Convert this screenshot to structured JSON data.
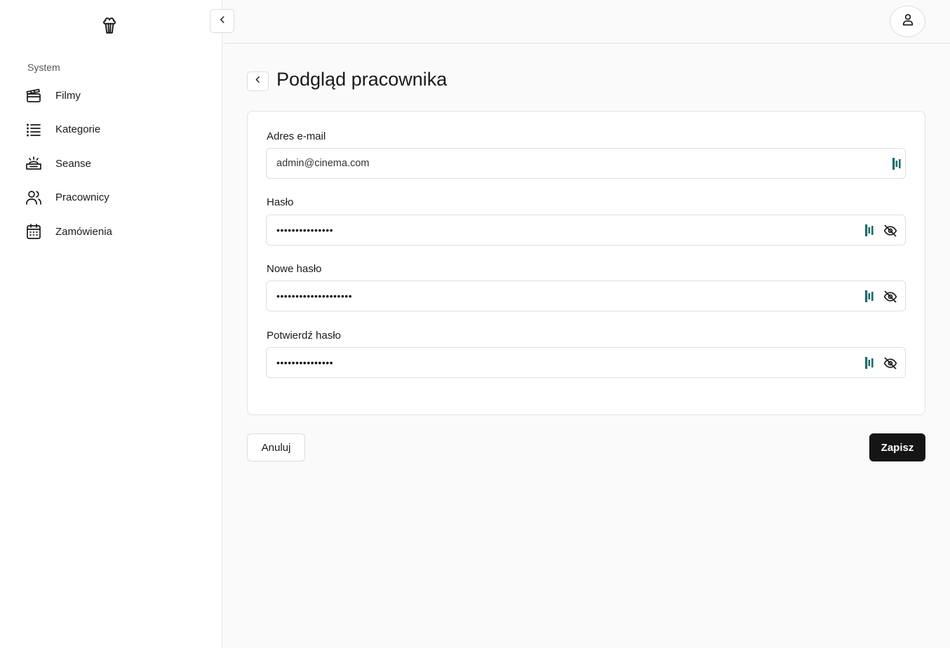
{
  "sidebar": {
    "logo_icon": "popcorn-icon",
    "section_label": "System",
    "items": [
      {
        "label": "Filmy",
        "icon": "clapperboard-icon"
      },
      {
        "label": "Kategorie",
        "icon": "list-icon"
      },
      {
        "label": "Seanse",
        "icon": "popcorn-ticket-icon"
      },
      {
        "label": "Pracownicy",
        "icon": "users-icon"
      },
      {
        "label": "Zamówienia",
        "icon": "calendar-icon"
      }
    ]
  },
  "header": {
    "collapse_icon": "chevron-left-icon",
    "user_icon": "user-icon"
  },
  "page": {
    "title": "Podgląd pracownika",
    "back_icon": "chevron-left-icon"
  },
  "form": {
    "email": {
      "label": "Adres e-mail",
      "value": "admin@cinema.com"
    },
    "password": {
      "label": "Hasło",
      "value": "•••••••••••••••"
    },
    "new_password": {
      "label": "Nowe hasło",
      "value": "••••••••••••••••••••"
    },
    "confirm_password": {
      "label": "Potwierdź hasło",
      "value": "•••••••••••••••"
    }
  },
  "actions": {
    "cancel_label": "Anuluj",
    "save_label": "Zapisz"
  },
  "colors": {
    "primary": "#151515",
    "password_manager_accent": "#1f6b6b",
    "background": "#fafafa"
  }
}
